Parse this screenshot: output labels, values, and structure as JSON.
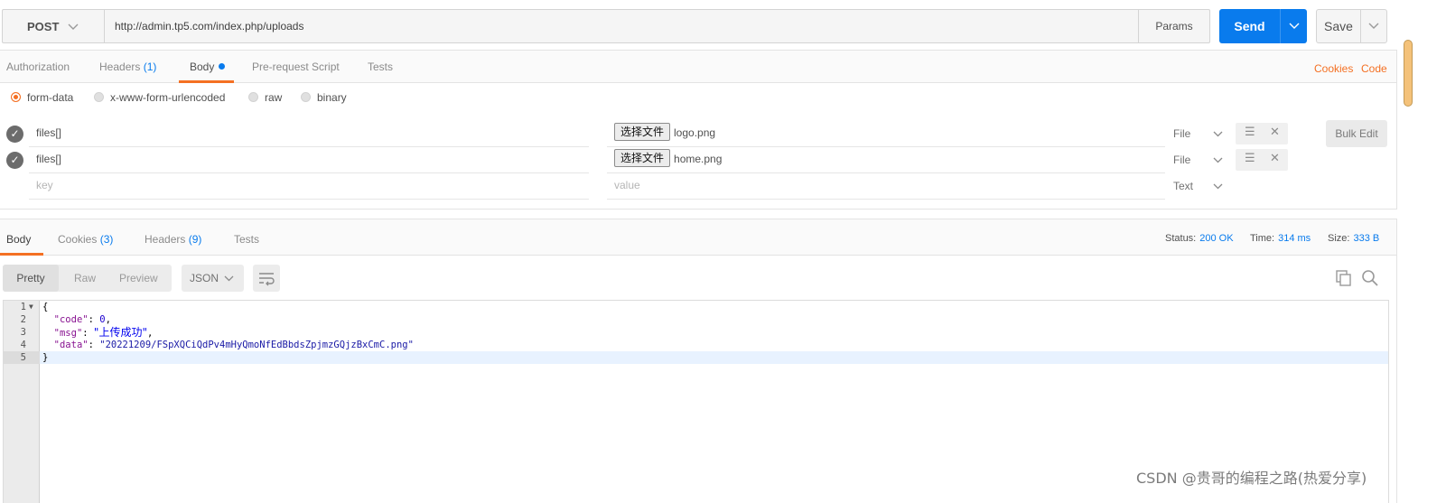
{
  "request": {
    "method": "POST",
    "url": "http://admin.tp5.com/index.php/uploads",
    "params_label": "Params",
    "send_label": "Send",
    "save_label": "Save"
  },
  "request_tabs": [
    {
      "label": "Authorization",
      "count": ""
    },
    {
      "label": "Headers",
      "count": "(1)"
    },
    {
      "label": "Body",
      "count": ""
    },
    {
      "label": "Pre-request Script",
      "count": ""
    },
    {
      "label": "Tests",
      "count": ""
    }
  ],
  "links": {
    "cookies": "Cookies",
    "code": "Code"
  },
  "body_types": [
    {
      "label": "form-data",
      "selected": true
    },
    {
      "label": "x-www-form-urlencoded",
      "selected": false
    },
    {
      "label": "raw",
      "selected": false
    },
    {
      "label": "binary",
      "selected": false
    }
  ],
  "form_rows": [
    {
      "key": "files[]",
      "file_button": "选择文件",
      "value": "logo.png",
      "type": "File"
    },
    {
      "key": "files[]",
      "file_button": "选择文件",
      "value": "home.png",
      "type": "File"
    }
  ],
  "empty_row": {
    "key_placeholder": "key",
    "value_placeholder": "value",
    "type": "Text"
  },
  "bulk_edit_label": "Bulk Edit",
  "response_tabs": [
    {
      "label": "Body",
      "count": ""
    },
    {
      "label": "Cookies",
      "count": "(3)"
    },
    {
      "label": "Headers",
      "count": "(9)"
    },
    {
      "label": "Tests",
      "count": ""
    }
  ],
  "response_status": {
    "status_label": "Status:",
    "status_value": "200 OK",
    "time_label": "Time:",
    "time_value": "314 ms",
    "size_label": "Size:",
    "size_value": "333 B"
  },
  "view_modes": [
    "Pretty",
    "Raw",
    "Preview"
  ],
  "format_select": "JSON",
  "code": {
    "line_numbers": [
      "1",
      "2",
      "3",
      "4",
      "5"
    ],
    "open_brace": "{",
    "close_brace": "}",
    "code_key": "\"code\"",
    "code_value": "0",
    "msg_key": "\"msg\"",
    "msg_value": "\"上传成功\"",
    "data_key": "\"data\"",
    "data_value": "\"20221209/FSpXQCiQdPv4mHyQmoNfEdBbdsZpjmzGQjzBxCmC.png\""
  },
  "watermark": "CSDN @贵哥的编程之路(热爱分享)",
  "colors": {
    "accent_orange": "#f47023",
    "accent_blue": "#097bed"
  }
}
